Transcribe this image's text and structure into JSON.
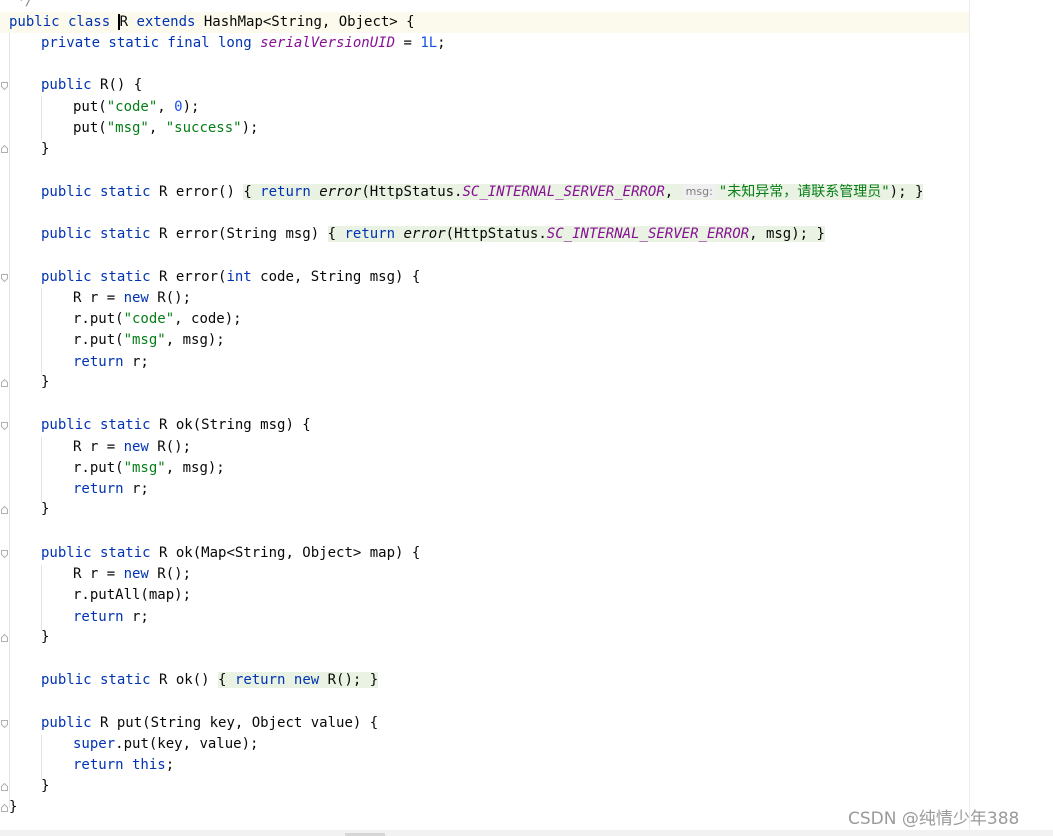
{
  "editor": {
    "comment_end": "*/",
    "lines": {
      "class_decl": {
        "kw1": "public class ",
        "class_name": "R",
        "kw2": " extends ",
        "super_type": "HashMap<String, Object> {"
      },
      "serial": {
        "kw": "private static final long ",
        "field": "serialVersionUID",
        "eq": " = ",
        "value": "1L",
        "end": ";"
      },
      "ctor": {
        "kw": "public ",
        "rest": "R() {"
      },
      "put_code": {
        "pre": "put(",
        "str": "\"code\"",
        "mid": ", ",
        "num": "0",
        "end": ");"
      },
      "put_msg": {
        "pre": "put(",
        "str1": "\"msg\"",
        "mid": ", ",
        "str2": "\"success\"",
        "end": ");"
      },
      "close": "}",
      "error0": {
        "kw": "public static ",
        "rest": "R error()",
        "sp": " ",
        "obrace": "{",
        "ret": " return ",
        "call": "error",
        "args": "(HttpStatus.",
        "const": "SC_INTERNAL_SERVER_ERROR",
        "comma": ", ",
        "hint": "msg:",
        "str": "\"未知异常，请联系管理员\"",
        "end": ");",
        "cbrace": "}"
      },
      "error1": {
        "kw": "public static ",
        "rest": "R error(String msg)",
        "sp": " ",
        "obrace": "{",
        "ret": " return ",
        "call": "error",
        "args": "(HttpStatus.",
        "const": "SC_INTERNAL_SERVER_ERROR",
        "tail": ", msg);",
        "cbrace": "}"
      },
      "error2": {
        "kw": "public static ",
        "rest": "R error(",
        "kw2": "int",
        "rest2": " code, String msg) {"
      },
      "new_r": {
        "pre": "R r = ",
        "kw": "new",
        "post": " R();"
      },
      "rput_code": {
        "pre": "r.put(",
        "str": "\"code\"",
        "post": ", code);"
      },
      "rput_msg": {
        "pre": "r.put(",
        "str": "\"msg\"",
        "post": ", msg);"
      },
      "ret_r": {
        "kw": "return",
        "post": " r;"
      },
      "ok1": {
        "kw": "public static ",
        "rest": "R ok(String msg) {"
      },
      "ok2": {
        "kw": "public static ",
        "rest": "R ok(Map<String, Object> map) {"
      },
      "putall": "r.putAll(map);",
      "ok0": {
        "kw": "public static ",
        "rest": "R ok()",
        "sp": " ",
        "obrace": "{",
        "ret": " return ",
        "kw2": "new",
        "post": " R();",
        "cbrace": "}"
      },
      "put": {
        "kw": "public ",
        "rest": "R put(String key, Object value) {"
      },
      "super_put": {
        "kw": "super",
        "post": ".put(key, value);"
      },
      "ret_this": {
        "kw": "return this",
        "post": ";"
      }
    }
  },
  "watermark": "CSDN @纯情少年388",
  "colors": {
    "keyword": "#0033b3",
    "string": "#067d17",
    "number": "#1750eb",
    "field": "#871094",
    "text": "#080808",
    "fold_bg": "#e9f2e3"
  }
}
